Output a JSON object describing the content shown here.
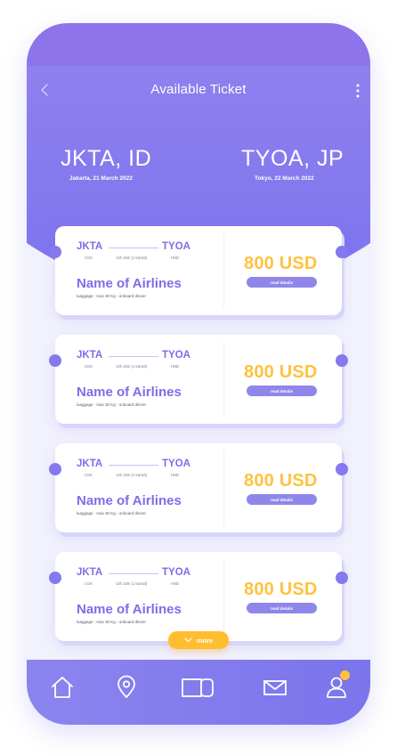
{
  "header": {
    "title": "Available Ticket",
    "back_icon": "chevron-left-icon",
    "menu_icon": "more-vertical-icon"
  },
  "route": {
    "origin": {
      "code": "JKTA, ID",
      "detail": "Jakarta, 21 March 2022"
    },
    "destination": {
      "code": "TYOA, JP",
      "detail": "Tokyo, 22 March 2022"
    }
  },
  "tickets": [
    {
      "from": "JKTA",
      "to": "TYOA",
      "from_airport": "CGK",
      "duration": "14h 15m (1 transit)",
      "to_airport": "HND",
      "airline": "Name of Airlines",
      "luggage": "luaggage : max 30 Kg - onboard dinner",
      "price": "800 USD",
      "details_label": "read details"
    },
    {
      "from": "JKTA",
      "to": "TYOA",
      "from_airport": "CGK",
      "duration": "14h 15m (1 transit)",
      "to_airport": "HND",
      "airline": "Name of Airlines",
      "luggage": "luaggage : max 30 Kg - onboard dinner",
      "price": "800 USD",
      "details_label": "read details"
    },
    {
      "from": "JKTA",
      "to": "TYOA",
      "from_airport": "CGK",
      "duration": "14h 15m (1 transit)",
      "to_airport": "HND",
      "airline": "Name of Airlines",
      "luggage": "luaggage : max 30 Kg - onboard dinner",
      "price": "800 USD",
      "details_label": "read details"
    },
    {
      "from": "JKTA",
      "to": "TYOA",
      "from_airport": "CGK",
      "duration": "14h 15m (1 transit)",
      "to_airport": "HND",
      "airline": "Name of Airlines",
      "luggage": "luaggage : max 30 Kg - onboard dinner",
      "price": "800 USD",
      "details_label": "read details"
    }
  ],
  "more_button": {
    "label": "more",
    "icon": "chevron-down-icon"
  },
  "bottom_nav": {
    "items": [
      "home-icon",
      "location-pin-icon",
      "tickets-icon",
      "mail-icon",
      "profile-icon"
    ]
  },
  "colors": {
    "primary": "#7b72ee",
    "accent": "#ffc23f",
    "background": "#f2f2fd"
  }
}
